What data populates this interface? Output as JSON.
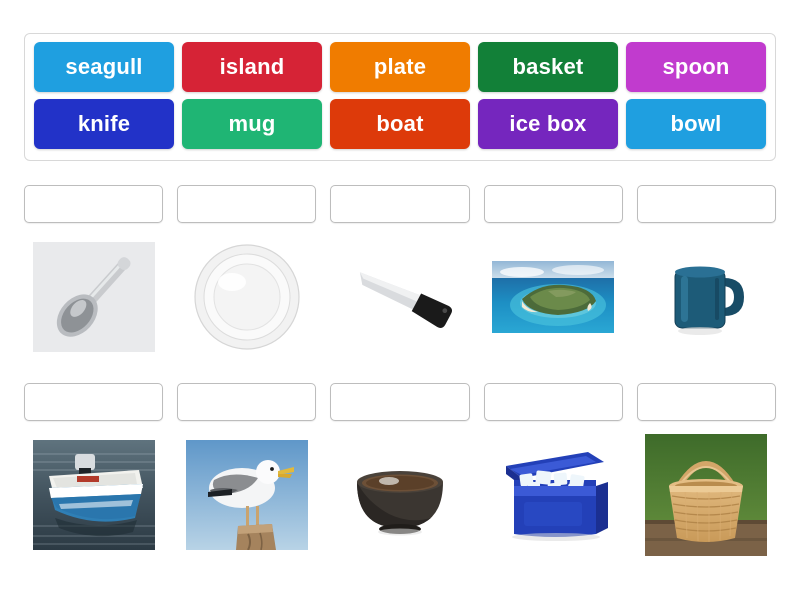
{
  "activity": {
    "type": "match-up",
    "background_color": "#ffffff"
  },
  "word_bank": {
    "border_color": "#d8d8d8",
    "rows": [
      [
        {
          "label": "seagull",
          "color": "#1F9FE0"
        },
        {
          "label": "island",
          "color": "#D62336"
        },
        {
          "label": "plate",
          "color": "#F07C00"
        },
        {
          "label": "basket",
          "color": "#128038"
        },
        {
          "label": "spoon",
          "color": "#C13BCE"
        }
      ],
      [
        {
          "label": "knife",
          "color": "#2232C8"
        },
        {
          "label": "mug",
          "color": "#1FB574"
        },
        {
          "label": "boat",
          "color": "#DD3A0A"
        },
        {
          "label": "ice box",
          "color": "#7526BE"
        },
        {
          "label": "bowl",
          "color": "#1F9FE0"
        }
      ]
    ]
  },
  "question_rows": [
    {
      "cells": [
        {
          "answer_value": "",
          "image_name": "spoon-photo",
          "image_alt": "silver spoon on grey background"
        },
        {
          "answer_value": "",
          "image_name": "plate-photo",
          "image_alt": "white ceramic dinner plate"
        },
        {
          "answer_value": "",
          "image_name": "knife-photo",
          "image_alt": "chef knife with black handle"
        },
        {
          "answer_value": "",
          "image_name": "island-photo",
          "image_alt": "tropical island in blue sea"
        },
        {
          "answer_value": "",
          "image_name": "mug-photo",
          "image_alt": "dark blue coffee mug"
        }
      ]
    },
    {
      "cells": [
        {
          "answer_value": "",
          "image_name": "boat-photo",
          "image_alt": "blue and white boat on water"
        },
        {
          "answer_value": "",
          "image_name": "seagull-photo",
          "image_alt": "seagull standing on wooden post"
        },
        {
          "answer_value": "",
          "image_name": "bowl-photo",
          "image_alt": "dark brown bowl"
        },
        {
          "answer_value": "",
          "image_name": "ice-box-photo",
          "image_alt": "blue cooler box filled with ice"
        },
        {
          "answer_value": "",
          "image_name": "basket-photo",
          "image_alt": "wicker basket with handle on grass"
        }
      ]
    }
  ],
  "drop_zone": {
    "placeholder": "",
    "border_color": "#bdbdbd"
  }
}
